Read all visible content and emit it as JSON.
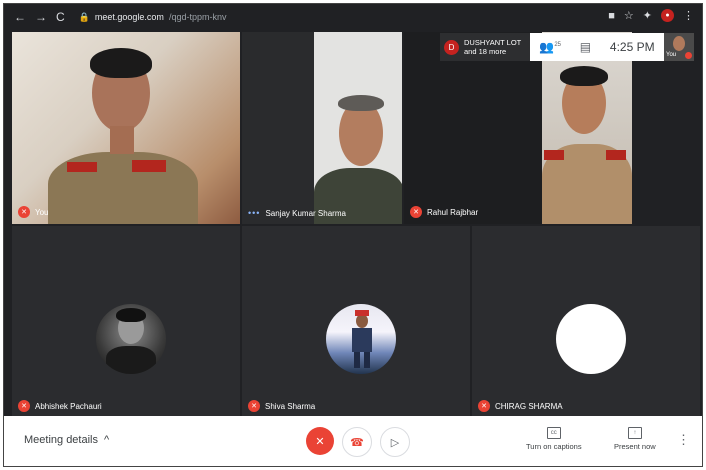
{
  "browser": {
    "url_host": "meet.google.com",
    "url_path": "/qgd-tppm-knv"
  },
  "participants_chip": {
    "initial": "D",
    "line1": "DUSHYANT LOT",
    "line2": "and 18 more"
  },
  "topbar": {
    "people_count": "25",
    "time": "4:25 PM",
    "self_label": "You"
  },
  "tiles": [
    {
      "name": "You",
      "muted": true
    },
    {
      "name": "Sanjay Kumar Sharma",
      "muted": false,
      "speaking": true
    },
    {
      "name": "Rahul Rajbhar",
      "muted": true
    },
    {
      "name": "Abhishek Pachauri",
      "muted": true
    },
    {
      "name": "Shiva Sharma",
      "muted": true
    },
    {
      "name": "CHIRAG SHARMA",
      "muted": true
    }
  ],
  "bottom": {
    "meeting_details": "Meeting details",
    "captions": "Turn on captions",
    "present": "Present now"
  },
  "colors": {
    "accent_red": "#ea4335",
    "dark_bg": "#202124"
  }
}
